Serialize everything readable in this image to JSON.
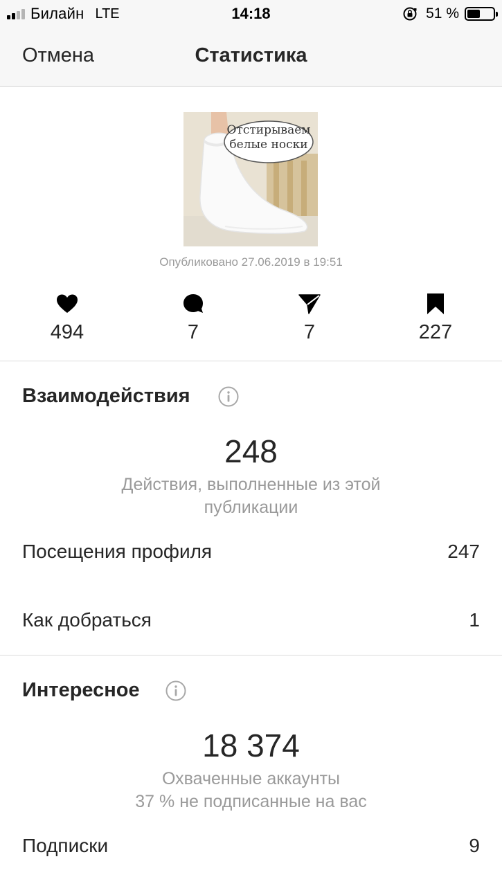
{
  "status_bar": {
    "carrier": "Билайн",
    "network": "LTE",
    "time": "14:18",
    "battery_percent": "51 %",
    "battery_level": 0.51,
    "signal_bars_active": 2,
    "signal_bars_total": 4
  },
  "nav": {
    "cancel_label": "Отмена",
    "title": "Статистика"
  },
  "post": {
    "image_caption_line1": "Отстирываем",
    "image_caption_line2": "белые носки",
    "published": "Опубликовано 27.06.2019 в 19:51"
  },
  "metrics": {
    "likes": "494",
    "comments": "7",
    "shares": "7",
    "saves": "227"
  },
  "interactions": {
    "title": "Взаимодействия",
    "total": "248",
    "caption_line1": "Действия, выполненные из этой",
    "caption_line2": "публикации",
    "rows": [
      {
        "label": "Посещения профиля",
        "value": "247"
      },
      {
        "label": "Как добраться",
        "value": "1"
      }
    ]
  },
  "discovery": {
    "title": "Интересное",
    "total": "18 374",
    "caption_line1": "Охваченные аккаунты",
    "caption_line2": "37 % не подписанные на вас",
    "rows": [
      {
        "label": "Подписки",
        "value": "9"
      }
    ]
  },
  "colors": {
    "text": "#262626",
    "muted": "#9a9a9a",
    "bar_bg": "#f7f7f7",
    "divider": "#dbdbdb"
  }
}
